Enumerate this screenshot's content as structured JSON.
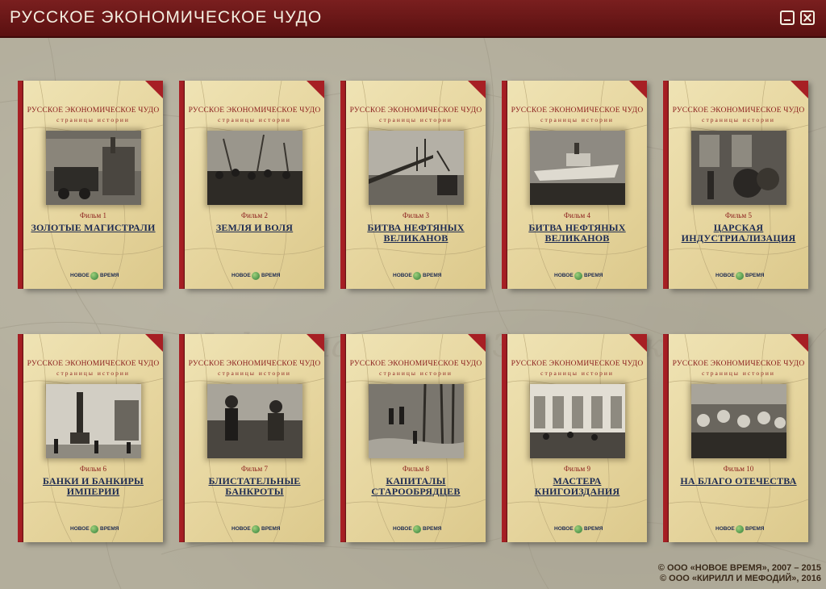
{
  "window": {
    "title": "РУССКОЕ ЭКОНОМИЧЕСКОЕ ЧУДО",
    "minimize_icon": "minimize-icon",
    "close_icon": "close-icon"
  },
  "series": {
    "title": "РУССКОЕ ЭКОНОМИЧЕСКОЕ ЧУДО",
    "subtitle": "страницы истории",
    "logo_left": "НОВОЕ",
    "logo_right": "ВРЕМЯ"
  },
  "films": [
    {
      "number": "Фильм 1",
      "title": "Золотые магистрали"
    },
    {
      "number": "Фильм 2",
      "title": "Земля и воля"
    },
    {
      "number": "Фильм 3",
      "title": "Битва нефтяных великанов"
    },
    {
      "number": "Фильм 4",
      "title": "Битва нефтяных великанов"
    },
    {
      "number": "Фильм 5",
      "title": "Царская индустриализация"
    },
    {
      "number": "Фильм 6",
      "title": "Банки и банкиры империи"
    },
    {
      "number": "Фильм 7",
      "title": "Блистательные банкроты"
    },
    {
      "number": "Фильм 8",
      "title": "Капиталы старообрядцев"
    },
    {
      "number": "Фильм 9",
      "title": "Мастера книгоиздания"
    },
    {
      "number": "Фильм 10",
      "title": "На благо отечества"
    }
  ],
  "footer": {
    "line1": "© ООО «НОВОЕ ВРЕМЯ», 2007 – 2015",
    "line2": "© ООО «КИРИЛЛ И МЕФОДИЙ», 2016"
  },
  "colors": {
    "titlebar": "#6b1818",
    "spine": "#a71f24",
    "cover": "#e9d9a4",
    "series_text": "#8a1c1c",
    "film_title": "#1d2b52",
    "background": "#b3ae9c"
  }
}
